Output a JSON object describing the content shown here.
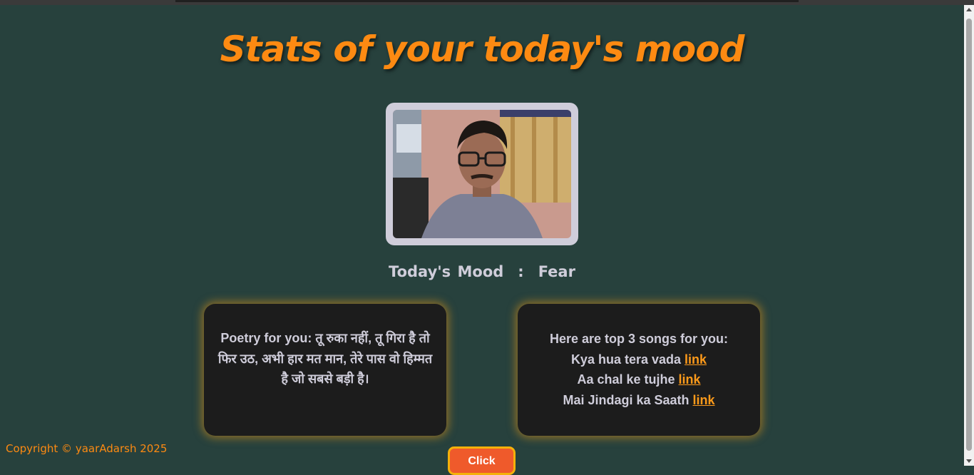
{
  "page": {
    "title": "Stats of your today's mood",
    "photo_alt": "webcam capture"
  },
  "mood": {
    "label": "Today's Mood",
    "separator": ":",
    "value": "Fear"
  },
  "poetry_card": {
    "text": "Poetry for you: तू रुका नहीं, तू गिरा है तो फिर उठ, अभी हार मत मान, तेरे पास वो हिम्मत है जो सबसे बड़ी है।"
  },
  "songs_card": {
    "heading": "Here are top 3 songs for you:",
    "songs": [
      {
        "title": "Kya hua tera vada",
        "link_label": "link"
      },
      {
        "title": "Aa chal ke tujhe",
        "link_label": "link"
      },
      {
        "title": "Mai Jindagi ka Saath",
        "link_label": "link"
      }
    ]
  },
  "footer": {
    "copyright": "Copyright © yaarAdarsh 2025"
  },
  "actions": {
    "click_label": "Click"
  },
  "colors": {
    "background": "#27413d",
    "accent": "#fd8a12",
    "card": "#1c1c1c",
    "button": "#ef5a2b"
  }
}
